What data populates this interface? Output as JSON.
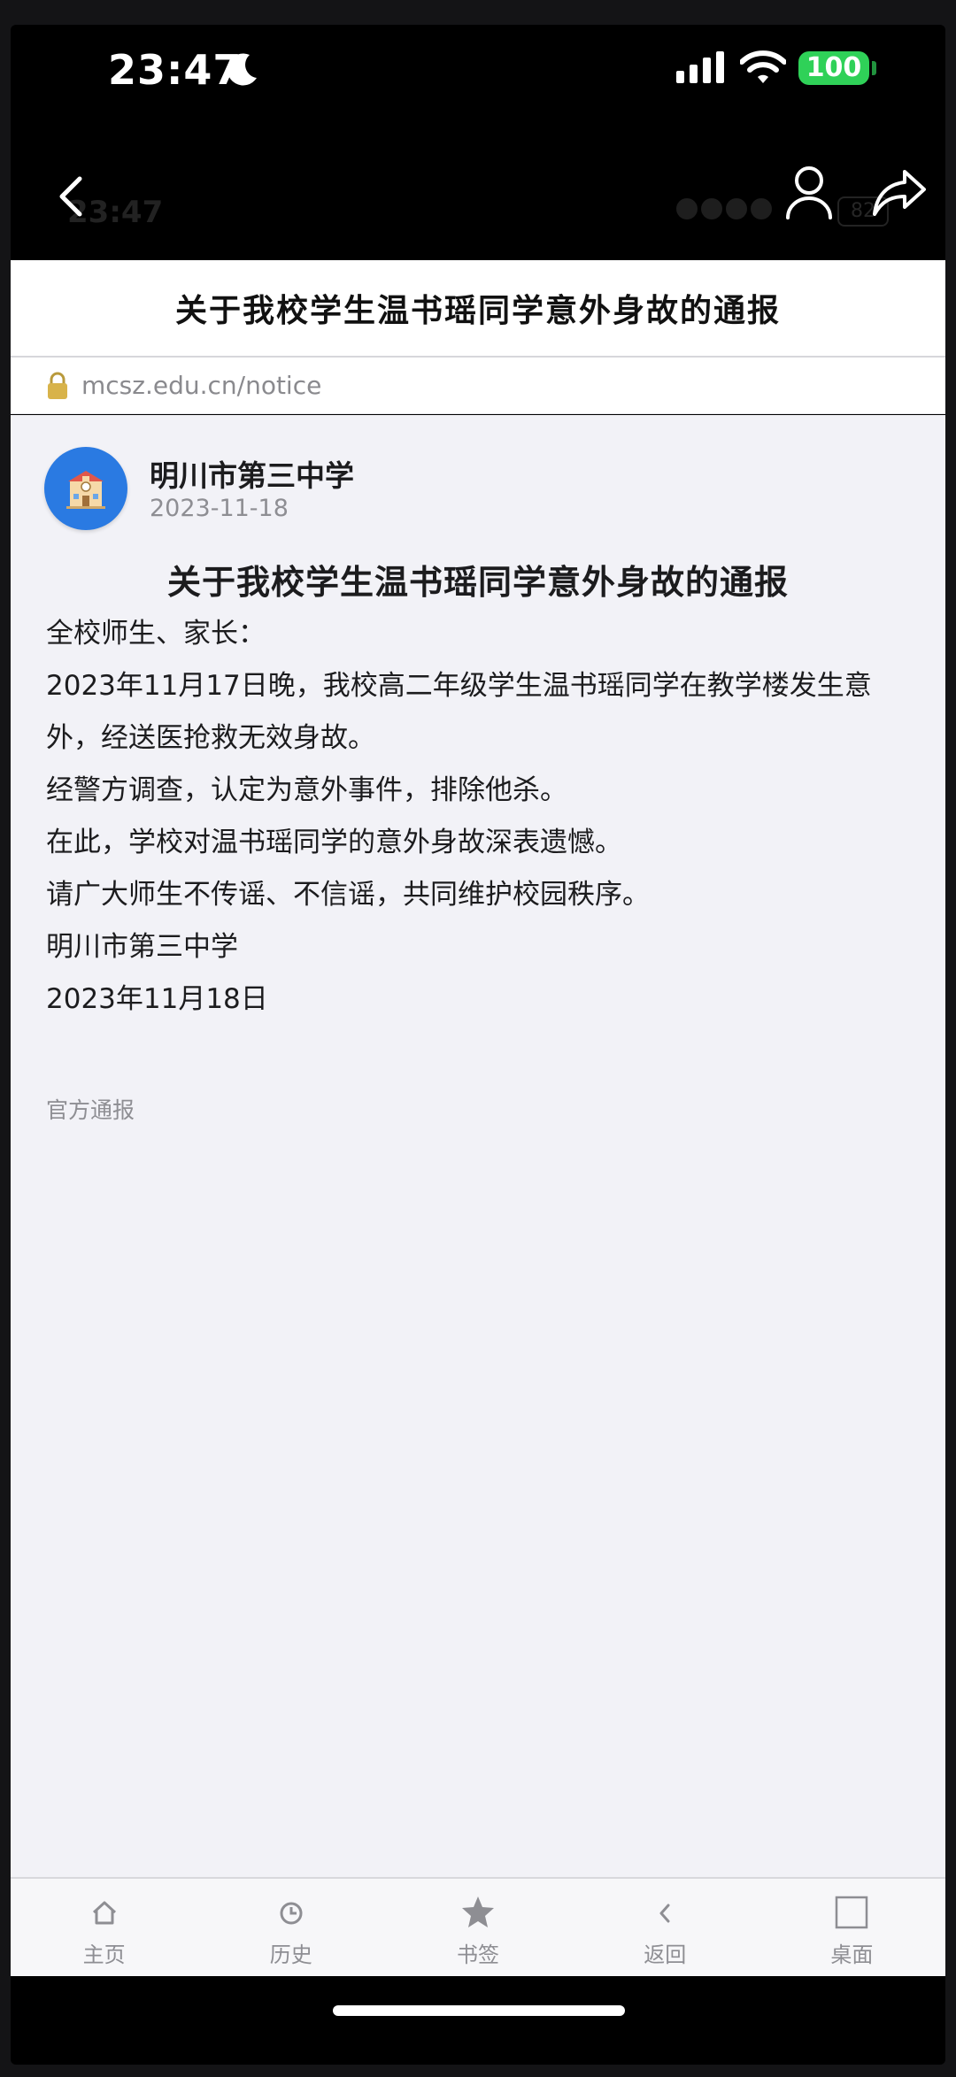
{
  "status_bar": {
    "time": "23:47",
    "battery": "100"
  },
  "ghost_bar": {
    "time": "23:47",
    "battery": "82"
  },
  "page": {
    "title": "关于我校学生温书瑶同学意外身故的通报",
    "url": "mcsz.edu.cn/notice"
  },
  "post": {
    "author": "明川市第三中学",
    "date": "2023-11-18",
    "title": "关于我校学生温书瑶同学意外身故的通报",
    "paragraphs": [
      "全校师生、家长：",
      "2023年11月17日晚，我校高二年级学生温书瑶同学在教学楼发生意外，经送医抢救无效身故。",
      "经警方调查，认定为意外事件，排除他杀。",
      "在此，学校对温书瑶同学的意外身故深表遗憾。",
      "请广大师生不传谣、不信谣，共同维护校园秩序。",
      "明川市第三中学",
      "2023年11月18日"
    ],
    "tag": "官方通报"
  },
  "toolbar": {
    "home": "主页",
    "history": "历史",
    "bookmarks": "书签",
    "back": "返回",
    "desktop": "桌面"
  },
  "colors": {
    "battery": "#2fd158",
    "avatar": "#2a7ae2",
    "background": "#f2f2f7"
  }
}
